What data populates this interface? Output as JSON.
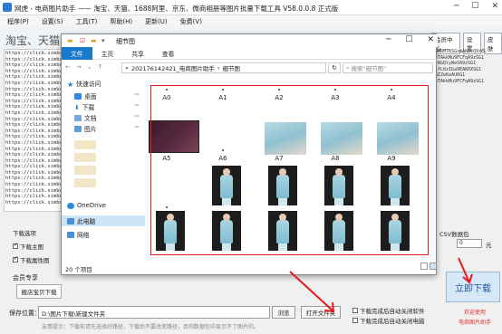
{
  "app": {
    "title": "网虎 - 电商图片助手 —— 淘宝、天猫、1688阿里、京东、微商相册等图片批量下载工具 V58.0.0.8 正式版",
    "menu": [
      "程序(P)",
      "设置(S)",
      "工具(T)",
      "帮助(H)",
      "更新(U)",
      "免费(V)"
    ],
    "heading": "淘宝、天猫、",
    "right_buttons": [
      "会员中心",
      "设置",
      "皮肤"
    ],
    "links": [
      "https://click.simba",
      "https://click.simba",
      "https://click.simba",
      "https://click.simba",
      "https://click.simba",
      "https://click.simba",
      "https://click.simba",
      "https://click.simba",
      "https://click.simba",
      "https://click.simba",
      "https://click.simba",
      "https://click.simba",
      "https://click.simba",
      "https://click.simba",
      "https://click.simba",
      "https://click.simba",
      "https://click.simba",
      "https://click.simba",
      "https://click.simba",
      "https://click.simba",
      "https://click.simba",
      "https://click.simba",
      "https://click.simba",
      "https://click.simba",
      "https://click.simba",
      "https://click.simba"
    ],
    "hash_lines": [
      "AMRMTKSGsmAKDcQ9rEL",
      "sTAkkMu9FCFqA9zSG1",
      "rAGQlyWeVA9zSG1",
      "lfL6zIGa9EAKRXSG1",
      "AIZeKeAU6G1",
      "sTAkkMu9FCFqA9zSG1"
    ],
    "options_label": "下载选项",
    "option_main": "下载主图",
    "option_attr": "下载属性图",
    "member_label": "会员专享",
    "shop_button": "搬店宝贝下载",
    "save_label": "保存位置：",
    "save_path": "D:\\图片下载\\新建文件夹",
    "browse": "浏览",
    "open_folder": "打开文件夹",
    "close_after1": "下载完成后自动关闭软件",
    "close_after2": "下载完成后自动关闭电脑",
    "tip": "友情提示：下载前请先选择好路径，下载后不要改变路径，否则数据包中显示不了图片的。",
    "download_button": "立即下载",
    "welcome": "欢迎使用",
    "brand": "电商图片助手",
    "csv_label": "CSV数据包",
    "csv_value": "0",
    "unit": "元",
    "right_checks": [
      "选择",
      "选择",
      "自动",
      "选择"
    ]
  },
  "explorer": {
    "title": "细节图",
    "ribbon_tabs": [
      "文件",
      "主页",
      "共享",
      "查看"
    ],
    "path": [
      "202176142421_电商图片助手",
      "细节图"
    ],
    "search_placeholder": "搜索\"细节图\"",
    "nav": {
      "quick_access": "快速访问",
      "desktop": "桌面",
      "downloads": "下载",
      "documents": "文档",
      "pictures": "图片",
      "onedrive": "OneDrive",
      "this_pc": "此电脑",
      "network": "网络"
    },
    "items": [
      {
        "name": "A0",
        "kind": "blank"
      },
      {
        "name": "A1",
        "kind": "blank"
      },
      {
        "name": "A2",
        "kind": "blank"
      },
      {
        "name": "A3",
        "kind": "blank"
      },
      {
        "name": "A4",
        "kind": "blank"
      },
      {
        "name": "A5",
        "kind": "screen"
      },
      {
        "name": "A6",
        "kind": "blank"
      },
      {
        "name": "A7",
        "kind": "fabric"
      },
      {
        "name": "A8",
        "kind": "fabric"
      },
      {
        "name": "A9",
        "kind": "fabric"
      },
      {
        "name": "B0",
        "kind": "blank"
      },
      {
        "name": "B1",
        "kind": "model"
      },
      {
        "name": "B2",
        "kind": "model"
      },
      {
        "name": "B3",
        "kind": "model"
      },
      {
        "name": "B4",
        "kind": "model"
      },
      {
        "name": "B5",
        "kind": "model"
      },
      {
        "name": "B6",
        "kind": "model"
      },
      {
        "name": "B7",
        "kind": "model"
      },
      {
        "name": "B8",
        "kind": "model"
      },
      {
        "name": "B9",
        "kind": "model"
      }
    ],
    "status": "20 个项目",
    "colors": {
      "file_tab": "#1979ca",
      "highlight": "#e8191b",
      "selected_nav": "#cce4f7"
    }
  }
}
